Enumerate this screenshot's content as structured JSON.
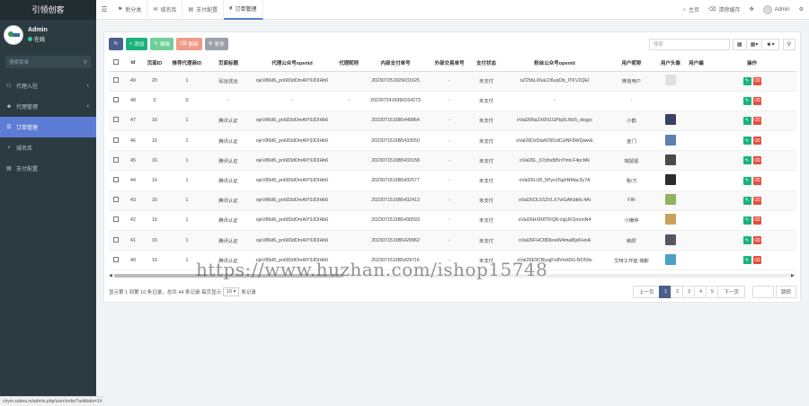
{
  "brand": "引领创客",
  "user": {
    "name": "Admin",
    "status": "在线"
  },
  "sidebar": {
    "search_placeholder": "搜索菜单",
    "items": [
      {
        "label": "代理入驻",
        "icon": "users-icon",
        "arrow": "‹"
      },
      {
        "label": "代理管理",
        "icon": "user-icon",
        "arrow": "‹"
      },
      {
        "label": "订单管理",
        "icon": "list-icon",
        "arrow": ""
      },
      {
        "label": "域名库",
        "icon": "globe-icon",
        "arrow": ""
      },
      {
        "label": "支付配置",
        "icon": "card-icon",
        "arrow": ""
      }
    ]
  },
  "topbar": {
    "tabs": [
      {
        "label": "新分类",
        "icon": "tag-icon"
      },
      {
        "label": "域名库",
        "icon": "chat-icon"
      },
      {
        "label": "支付配置",
        "icon": "doc-icon"
      },
      {
        "label": "订单管理",
        "icon": "yen-icon"
      }
    ],
    "home": "主页",
    "clear_cache": "清除缓存",
    "admin": "Admin"
  },
  "toolbar": {
    "add": "添加",
    "edit": "编辑",
    "delete": "删除",
    "more": "更多",
    "search_placeholder": "搜索"
  },
  "table": {
    "columns": [
      "Id",
      "页面ID",
      "推荐代理商ID",
      "页面标题",
      "代理公众号openid",
      "代理昵称",
      "内部支付单号",
      "外部交易单号",
      "支付状态",
      "粉丝公众号openid",
      "用户昵称",
      "用户头像",
      "用户编",
      "操作"
    ],
    "rows": [
      {
        "id": "49",
        "page": "20",
        "ref": "1",
        "title": "砧运送运",
        "aopenid": "ojeV86d6_pn683dOmAlY9JDIHb6",
        "anick": "",
        "order": "20230725160S031625",
        "ext": "-",
        "status": "未支付",
        "fopenid": "oZ25bLX6aLD6uqOb_ITKV2QEI",
        "nick": "微信用户",
        "avatar": "#e0e0e0"
      },
      {
        "id": "48",
        "page": "0",
        "ref": "0",
        "title": "-",
        "aopenid": "-",
        "anick": "-",
        "order": "2023072416990164273",
        "ext": "-",
        "status": "未支付",
        "fopenid": "-",
        "nick": "-",
        "avatar": ""
      },
      {
        "id": "47",
        "page": "16",
        "ref": "1",
        "title": "腾讯认证",
        "aopenid": "ojeV86d6_pn683dOmAlY9JDIHb6",
        "anick": "",
        "order": "2023071616B5440864",
        "ext": "-",
        "status": "未支付",
        "fopenid": "oVal26Na2X6N1GPbjXLMz5_degyc",
        "nick": "小鹤",
        "avatar": "#3a3f66"
      },
      {
        "id": "46",
        "page": "16",
        "ref": "1",
        "title": "腾讯认证",
        "aopenid": "ojeV86d6_pn683dOmAlY9JDIHb6",
        "anick": "",
        "order": "2023071516B5433550",
        "ext": "-",
        "status": "未支付",
        "fopenid": "oVal26DzDtaW381dCulNF8WQwwE",
        "nick": "金门",
        "avatar": "#5a7fb3"
      },
      {
        "id": "45",
        "page": "16",
        "ref": "1",
        "title": "腾讯认证",
        "aopenid": "ojeV86d6_pn683dOmAlY9JDIHb6",
        "anick": "",
        "order": "2023071516B5433158",
        "ext": "-",
        "status": "未支付",
        "fopenid": "oVal26L_67pfsd95nYImLF4pcMk",
        "nick": "瑞鼠鼠",
        "avatar": "#4a4a4a"
      },
      {
        "id": "44",
        "page": "16",
        "ref": "1",
        "title": "腾讯认证",
        "aopenid": "ojeV86d6_pn683dOmAlY9JDIHb6",
        "anick": "",
        "order": "2023071516B5432577",
        "ext": "-",
        "status": "未支付",
        "fopenid": "oVal26LUfl_5Pyo1NghNMac3y7A",
        "nick": "我/方",
        "avatar": "#2b2b2b"
      },
      {
        "id": "43",
        "page": "16",
        "ref": "1",
        "title": "腾讯认证",
        "aopenid": "ojeV86d6_pn683dOmAlY9JDIHb6",
        "anick": "",
        "order": "2023071516B5432413",
        "ext": "-",
        "status": "未支付",
        "fopenid": "oVal26OL5S2VLX7vIGAKbkhL4AI",
        "nick": "FIR",
        "avatar": "#8fb45a"
      },
      {
        "id": "42",
        "page": "16",
        "ref": "1",
        "title": "腾讯认证",
        "aopenid": "ojeV86d6_pn683dOmAlY9JDIHb6",
        "anick": "",
        "order": "2023071516B5430593",
        "ext": "-",
        "status": "未支付",
        "fopenid": "oVal26HXR8TRQ8-clgUKSmonN4",
        "nick": "小懒仲",
        "avatar": "#c9a25a"
      },
      {
        "id": "41",
        "page": "16",
        "ref": "1",
        "title": "腾讯认证",
        "aopenid": "ojeV86d6_pn683dOmAlY9JDIHb6",
        "anick": "",
        "order": "2023071516B5429962",
        "ext": "-",
        "status": "未支付",
        "fopenid": "oVal26FHC6fDlewW4ma8ljsKHoA",
        "nick": "荣辰'",
        "avatar": "#555566"
      },
      {
        "id": "40",
        "page": "16",
        "ref": "1",
        "title": "腾讯认证",
        "aopenid": "ojeV86d6_pn683dOmAlY9JDIHb6",
        "anick": "",
        "order": "2023071516B5429716",
        "ext": "-",
        "status": "未支付",
        "fopenid": "oVal26E9CBiyqjFo8Vmk5G-NO59o",
        "nick": "艾特工作室-瑞斯",
        "avatar": "#4aa0c8"
      }
    ]
  },
  "footer": {
    "info_prefix": "显示第 1 到第 10 条记录，总共 44 条记录 每页显示",
    "page_size": "10",
    "info_suffix": "条记录",
    "prev": "上一页",
    "pages": [
      "1",
      "2",
      "3",
      "4",
      "5"
    ],
    "next": "下一页",
    "go": "跳转"
  },
  "watermark": "https://www.huzhan.com/ishop15748",
  "status_url": "chym.xabea.m/admin.php/user/order?addtabs=1#"
}
